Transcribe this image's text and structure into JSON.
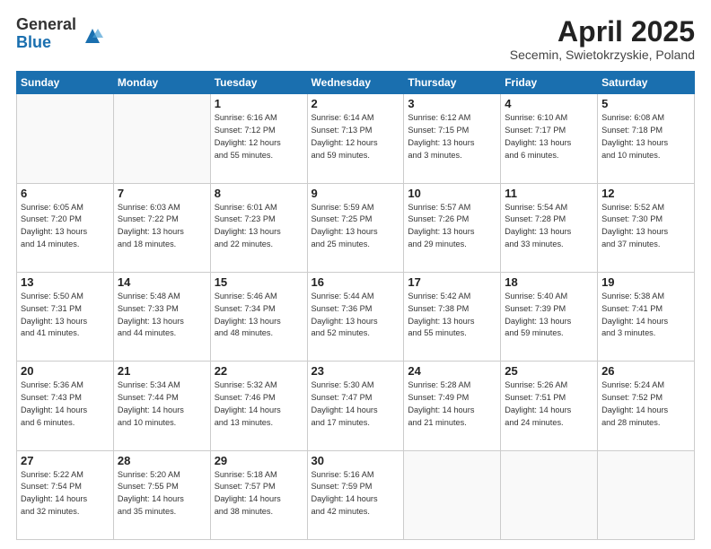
{
  "logo": {
    "general": "General",
    "blue": "Blue"
  },
  "title": "April 2025",
  "subtitle": "Secemin, Swietokrzyskie, Poland",
  "weekdays": [
    "Sunday",
    "Monday",
    "Tuesday",
    "Wednesday",
    "Thursday",
    "Friday",
    "Saturday"
  ],
  "weeks": [
    [
      {
        "day": "",
        "info": ""
      },
      {
        "day": "",
        "info": ""
      },
      {
        "day": "1",
        "info": "Sunrise: 6:16 AM\nSunset: 7:12 PM\nDaylight: 12 hours\nand 55 minutes."
      },
      {
        "day": "2",
        "info": "Sunrise: 6:14 AM\nSunset: 7:13 PM\nDaylight: 12 hours\nand 59 minutes."
      },
      {
        "day": "3",
        "info": "Sunrise: 6:12 AM\nSunset: 7:15 PM\nDaylight: 13 hours\nand 3 minutes."
      },
      {
        "day": "4",
        "info": "Sunrise: 6:10 AM\nSunset: 7:17 PM\nDaylight: 13 hours\nand 6 minutes."
      },
      {
        "day": "5",
        "info": "Sunrise: 6:08 AM\nSunset: 7:18 PM\nDaylight: 13 hours\nand 10 minutes."
      }
    ],
    [
      {
        "day": "6",
        "info": "Sunrise: 6:05 AM\nSunset: 7:20 PM\nDaylight: 13 hours\nand 14 minutes."
      },
      {
        "day": "7",
        "info": "Sunrise: 6:03 AM\nSunset: 7:22 PM\nDaylight: 13 hours\nand 18 minutes."
      },
      {
        "day": "8",
        "info": "Sunrise: 6:01 AM\nSunset: 7:23 PM\nDaylight: 13 hours\nand 22 minutes."
      },
      {
        "day": "9",
        "info": "Sunrise: 5:59 AM\nSunset: 7:25 PM\nDaylight: 13 hours\nand 25 minutes."
      },
      {
        "day": "10",
        "info": "Sunrise: 5:57 AM\nSunset: 7:26 PM\nDaylight: 13 hours\nand 29 minutes."
      },
      {
        "day": "11",
        "info": "Sunrise: 5:54 AM\nSunset: 7:28 PM\nDaylight: 13 hours\nand 33 minutes."
      },
      {
        "day": "12",
        "info": "Sunrise: 5:52 AM\nSunset: 7:30 PM\nDaylight: 13 hours\nand 37 minutes."
      }
    ],
    [
      {
        "day": "13",
        "info": "Sunrise: 5:50 AM\nSunset: 7:31 PM\nDaylight: 13 hours\nand 41 minutes."
      },
      {
        "day": "14",
        "info": "Sunrise: 5:48 AM\nSunset: 7:33 PM\nDaylight: 13 hours\nand 44 minutes."
      },
      {
        "day": "15",
        "info": "Sunrise: 5:46 AM\nSunset: 7:34 PM\nDaylight: 13 hours\nand 48 minutes."
      },
      {
        "day": "16",
        "info": "Sunrise: 5:44 AM\nSunset: 7:36 PM\nDaylight: 13 hours\nand 52 minutes."
      },
      {
        "day": "17",
        "info": "Sunrise: 5:42 AM\nSunset: 7:38 PM\nDaylight: 13 hours\nand 55 minutes."
      },
      {
        "day": "18",
        "info": "Sunrise: 5:40 AM\nSunset: 7:39 PM\nDaylight: 13 hours\nand 59 minutes."
      },
      {
        "day": "19",
        "info": "Sunrise: 5:38 AM\nSunset: 7:41 PM\nDaylight: 14 hours\nand 3 minutes."
      }
    ],
    [
      {
        "day": "20",
        "info": "Sunrise: 5:36 AM\nSunset: 7:43 PM\nDaylight: 14 hours\nand 6 minutes."
      },
      {
        "day": "21",
        "info": "Sunrise: 5:34 AM\nSunset: 7:44 PM\nDaylight: 14 hours\nand 10 minutes."
      },
      {
        "day": "22",
        "info": "Sunrise: 5:32 AM\nSunset: 7:46 PM\nDaylight: 14 hours\nand 13 minutes."
      },
      {
        "day": "23",
        "info": "Sunrise: 5:30 AM\nSunset: 7:47 PM\nDaylight: 14 hours\nand 17 minutes."
      },
      {
        "day": "24",
        "info": "Sunrise: 5:28 AM\nSunset: 7:49 PM\nDaylight: 14 hours\nand 21 minutes."
      },
      {
        "day": "25",
        "info": "Sunrise: 5:26 AM\nSunset: 7:51 PM\nDaylight: 14 hours\nand 24 minutes."
      },
      {
        "day": "26",
        "info": "Sunrise: 5:24 AM\nSunset: 7:52 PM\nDaylight: 14 hours\nand 28 minutes."
      }
    ],
    [
      {
        "day": "27",
        "info": "Sunrise: 5:22 AM\nSunset: 7:54 PM\nDaylight: 14 hours\nand 32 minutes."
      },
      {
        "day": "28",
        "info": "Sunrise: 5:20 AM\nSunset: 7:55 PM\nDaylight: 14 hours\nand 35 minutes."
      },
      {
        "day": "29",
        "info": "Sunrise: 5:18 AM\nSunset: 7:57 PM\nDaylight: 14 hours\nand 38 minutes."
      },
      {
        "day": "30",
        "info": "Sunrise: 5:16 AM\nSunset: 7:59 PM\nDaylight: 14 hours\nand 42 minutes."
      },
      {
        "day": "",
        "info": ""
      },
      {
        "day": "",
        "info": ""
      },
      {
        "day": "",
        "info": ""
      }
    ]
  ]
}
